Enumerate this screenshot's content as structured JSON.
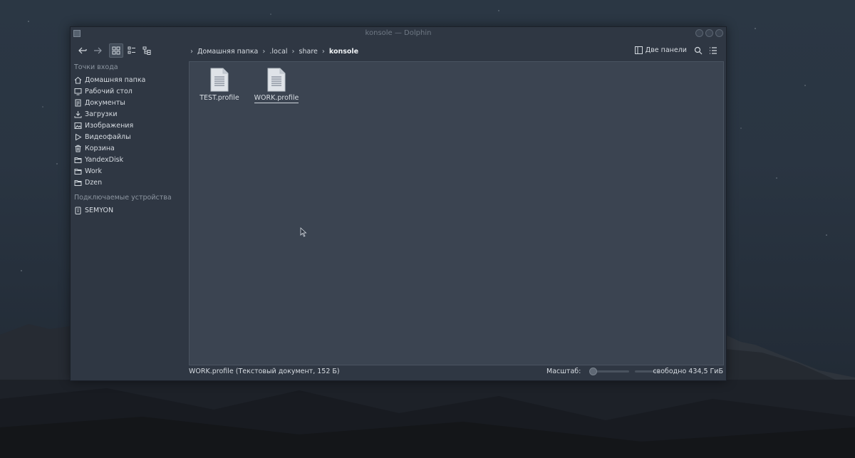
{
  "window": {
    "title": "konsole — Dolphin"
  },
  "toolbar": {
    "back_icon": "arrow-left-icon",
    "forward_icon": "arrow-right-icon",
    "icons_view_icon": "grid-icon",
    "compact_view_icon": "list-icon",
    "details_view_icon": "tree-icon",
    "breadcrumbs": [
      "Домашняя папка",
      ".local",
      "share",
      "konsole"
    ],
    "dual_panel_label": "Две панели"
  },
  "sidebar": {
    "places_heading": "Точки входа",
    "places": [
      {
        "label": "Домашняя папка",
        "icon": "home-icon"
      },
      {
        "label": "Рабочий стол",
        "icon": "desktop-icon"
      },
      {
        "label": "Документы",
        "icon": "document-icon"
      },
      {
        "label": "Загрузки",
        "icon": "download-icon"
      },
      {
        "label": "Изображения",
        "icon": "image-icon"
      },
      {
        "label": "Видеофайлы",
        "icon": "video-icon"
      },
      {
        "label": "Корзина",
        "icon": "trash-icon"
      },
      {
        "label": "YandexDisk",
        "icon": "folder-icon"
      },
      {
        "label": "Work",
        "icon": "folder-icon"
      },
      {
        "label": "Dzen",
        "icon": "folder-icon"
      }
    ],
    "devices_heading": "Подключаемые устройства",
    "devices": [
      {
        "label": "SEMYON",
        "icon": "usb-drive-icon"
      }
    ]
  },
  "files": [
    {
      "name": "TEST.profile",
      "icon": "text-file-icon",
      "selected": false
    },
    {
      "name": "WORK.profile",
      "icon": "text-file-icon",
      "selected": true
    }
  ],
  "statusbar": {
    "selection_info": "WORK.profile (Текстовый документ, 152 Б)",
    "zoom_label": "Масштаб:",
    "free_space": "свободно 434,5 ГиБ"
  }
}
